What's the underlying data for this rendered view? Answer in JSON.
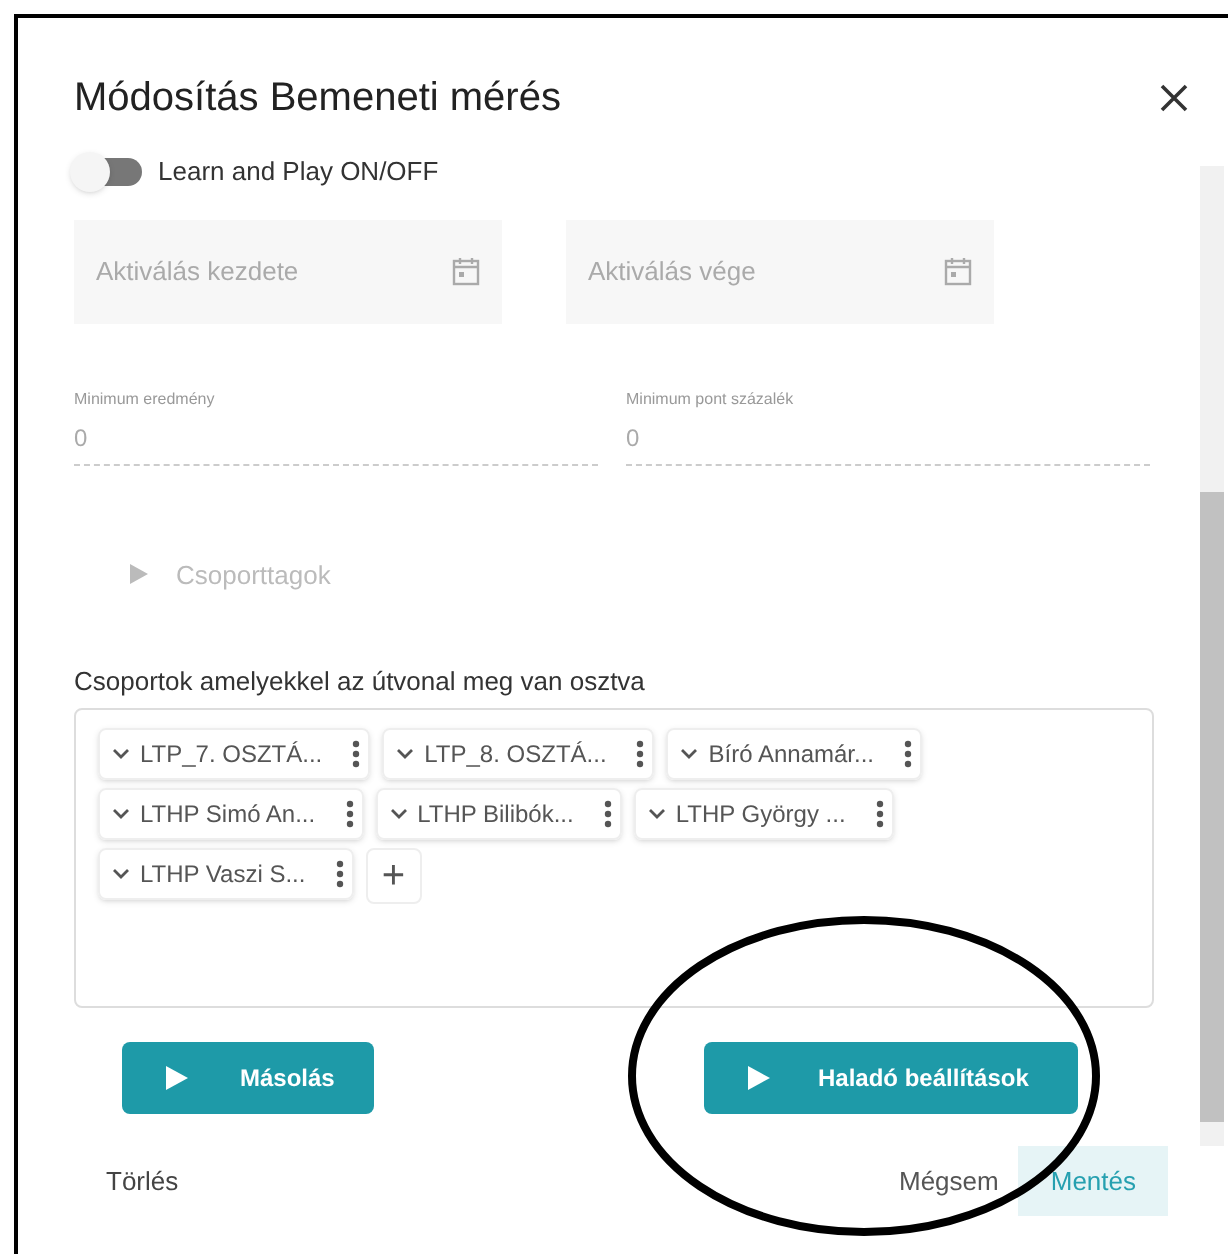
{
  "dialog": {
    "title": "Módosítás Bemeneti mérés"
  },
  "toggle": {
    "label": "Learn and Play ON/OFF",
    "on": false
  },
  "date_fields": [
    {
      "placeholder": "Aktiválás kezdete"
    },
    {
      "placeholder": "Aktiválás vége"
    }
  ],
  "number_fields": [
    {
      "label": "Minimum eredmény",
      "value": "0"
    },
    {
      "label": "Minimum pont százalék",
      "value": "0"
    }
  ],
  "group_members": {
    "label": "Csoporttagok",
    "disabled": true
  },
  "groups": {
    "label": "Csoportok amelyekkel az útvonal meg van osztva",
    "chips": [
      {
        "label": "LTP_7. OSZTÁ..."
      },
      {
        "label": "LTP_8. OSZTÁ..."
      },
      {
        "label": "Bíró Annamár..."
      },
      {
        "label": "LTHP Simó An..."
      },
      {
        "label": "LTHP Bilibók..."
      },
      {
        "label": "LTHP György ..."
      },
      {
        "label": "LTHP Vaszi S..."
      }
    ],
    "add": "+"
  },
  "actions": [
    {
      "label": "Másolás"
    },
    {
      "label": "Haladó beállítások"
    }
  ],
  "footer": {
    "delete": "Törlés",
    "cancel": "Mégsem",
    "save": "Mentés"
  }
}
